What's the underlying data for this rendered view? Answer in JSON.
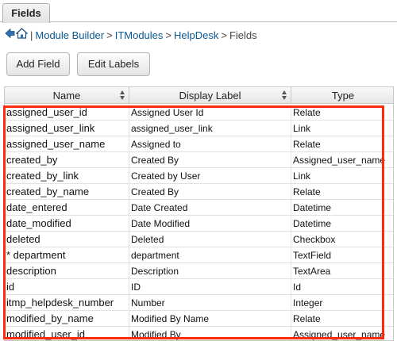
{
  "tabs": [
    {
      "label": "Fields"
    }
  ],
  "breadcrumb": {
    "separator": "|",
    "items": [
      "Module Builder",
      "ITModules",
      "HelpDesk"
    ],
    "current": "Fields",
    "arrow": ">"
  },
  "toolbar": {
    "add_field_label": "Add Field",
    "edit_labels_label": "Edit Labels"
  },
  "grid": {
    "columns": {
      "name": "Name",
      "display_label": "Display Label",
      "type": "Type"
    },
    "rows": [
      {
        "name": "assigned_user_id",
        "label": "Assigned User Id",
        "type": "Relate"
      },
      {
        "name": "assigned_user_link",
        "label": "assigned_user_link",
        "type": "Link"
      },
      {
        "name": "assigned_user_name",
        "label": "Assigned to",
        "type": "Relate"
      },
      {
        "name": "created_by",
        "label": "Created By",
        "type": "Assigned_user_name"
      },
      {
        "name": "created_by_link",
        "label": "Created by User",
        "type": "Link"
      },
      {
        "name": "created_by_name",
        "label": "Created By",
        "type": "Relate"
      },
      {
        "name": "date_entered",
        "label": "Date Created",
        "type": "Datetime"
      },
      {
        "name": "date_modified",
        "label": "Date Modified",
        "type": "Datetime"
      },
      {
        "name": "deleted",
        "label": "Deleted",
        "type": "Checkbox"
      },
      {
        "name": "* department",
        "label": "department",
        "type": "TextField"
      },
      {
        "name": "description",
        "label": "Description",
        "type": "TextArea"
      },
      {
        "name": "id",
        "label": "ID",
        "type": "Id"
      },
      {
        "name": "itmp_helpdesk_number",
        "label": "Number",
        "type": "Integer"
      },
      {
        "name": "modified_by_name",
        "label": "Modified By Name",
        "type": "Relate"
      },
      {
        "name": "modified_user_id",
        "label": "Modified By",
        "type": "Assigned_user_name"
      }
    ]
  },
  "colors": {
    "link": "#0b578f",
    "highlight": "#ff2a12"
  }
}
